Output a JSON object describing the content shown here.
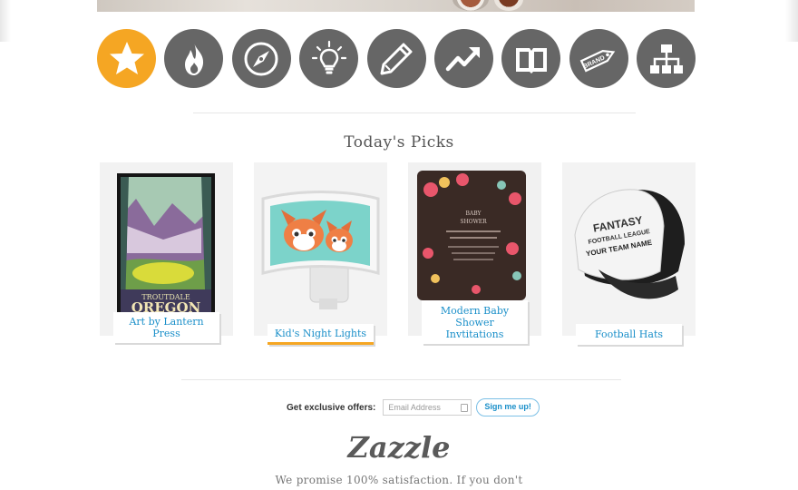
{
  "categories": [
    {
      "icon": "star-icon",
      "active": true
    },
    {
      "icon": "flame-icon"
    },
    {
      "icon": "compass-icon"
    },
    {
      "icon": "lightbulb-icon"
    },
    {
      "icon": "pencil-icon"
    },
    {
      "icon": "trending-up-icon"
    },
    {
      "icon": "book-icon"
    },
    {
      "icon": "brand-tag-icon",
      "tag_text": "BRAND"
    },
    {
      "icon": "sitemap-icon"
    }
  ],
  "picks": {
    "title": "Today's Picks",
    "items": [
      {
        "label": "Art by Lantern Press",
        "art_text": "TROUTDALE OREGON"
      },
      {
        "label": "Kid's Night Lights",
        "active": true
      },
      {
        "label": "Modern Baby Shower Invtitations",
        "art_text": "BABY SHOWER"
      },
      {
        "label": "Football Hats",
        "art_text": "FANTASY FOOTBALL LEAGUE YOUR TEAM NAME"
      }
    ]
  },
  "newsletter": {
    "label": "Get exclusive offers:",
    "email_placeholder": "Email Address",
    "signup_label": "Sign me up!"
  },
  "brand": {
    "logo_text": "Zazzle"
  },
  "promise_text": "We promise 100% satisfaction. If you don't",
  "colors": {
    "accent": "#f5a623",
    "icon_gray": "#666666",
    "link": "#1a8fc9"
  }
}
